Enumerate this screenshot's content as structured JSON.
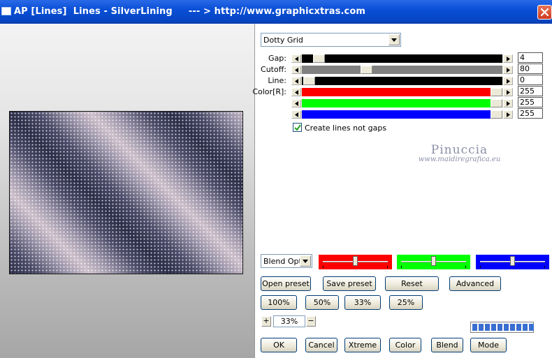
{
  "window": {
    "title": "AP [Lines]  Lines - SilverLining     --- > http://www.graphicxtras.com"
  },
  "preset": {
    "selected": "Dotty Grid"
  },
  "sliders": [
    {
      "label": "Gap:",
      "value": "4",
      "level": 0.06,
      "color": "#000000"
    },
    {
      "label": "Cutoff:",
      "value": "80",
      "level": 0.31,
      "color": "#808080"
    },
    {
      "label": "Line:",
      "value": "0",
      "level": 0.0,
      "color": "#000000"
    },
    {
      "label": "Color[R]:",
      "value": "255",
      "level": 1.0,
      "color": "#ff0000"
    },
    {
      "label": "",
      "value": "255",
      "level": 1.0,
      "color": "#00ff00"
    },
    {
      "label": "",
      "value": "255",
      "level": 1.0,
      "color": "#0000ff"
    }
  ],
  "option": {
    "label": "Create lines not gaps",
    "checked": true
  },
  "watermark": {
    "name": "Pinuccia",
    "url": "www.maidiregrafica.eu"
  },
  "blend": {
    "selected": "Blend Optio"
  },
  "color_boxes": [
    {
      "color": "#ff0000",
      "level": 0.5
    },
    {
      "color": "#00ff00",
      "level": 0.5
    },
    {
      "color": "#0000ff",
      "level": 0.5
    }
  ],
  "buttons_row1": [
    "Open preset",
    "Save preset",
    "Reset",
    "Advanced"
  ],
  "zoom_buttons": [
    "100%",
    "50%",
    "33%",
    "25%"
  ],
  "zoom": {
    "plus": "+",
    "value": "33%",
    "minus": "−"
  },
  "buttons_bottom": [
    "OK",
    "Cancel",
    "Xtreme",
    "Color",
    "Blend",
    "Mode"
  ],
  "progress": {
    "segments": 10,
    "filled": 10
  }
}
